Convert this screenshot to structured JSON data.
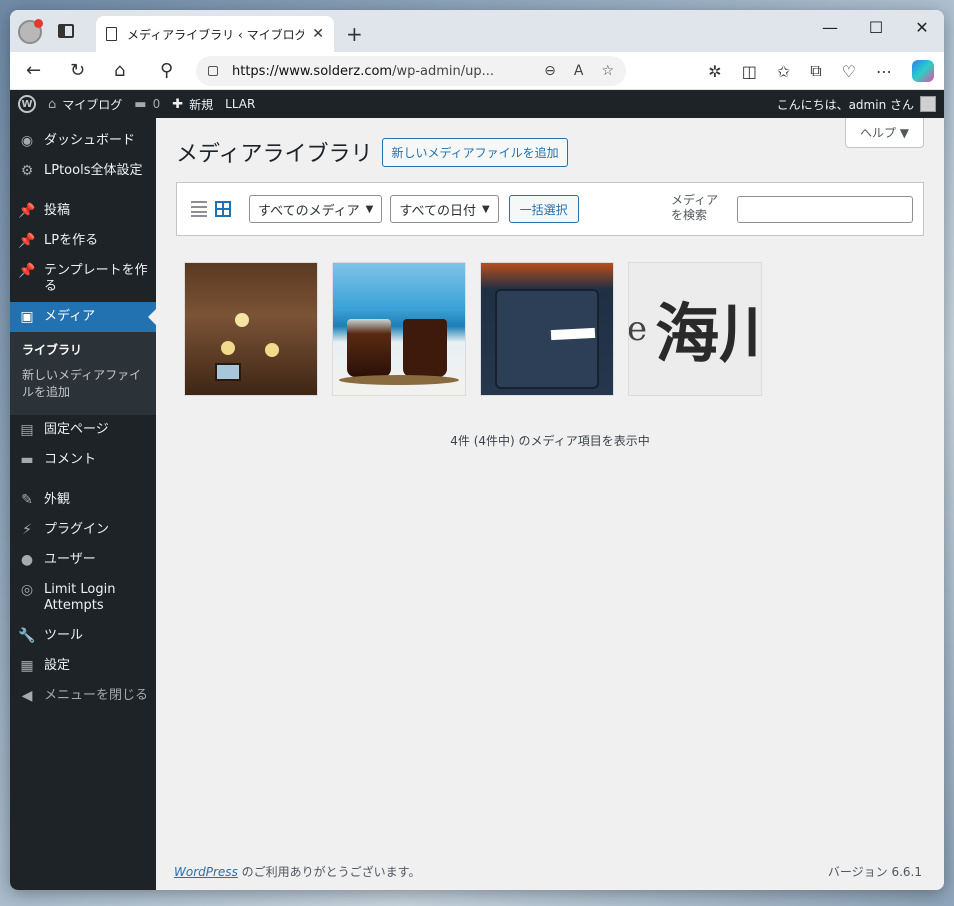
{
  "browser": {
    "tab_title": "メディアライブラリ ‹ マイブログ — Wor",
    "url_host": "https://www.solderz.com",
    "url_path": "/wp-admin/up...",
    "new_tab": "+",
    "win_min": "—",
    "win_max": "☐",
    "win_close": "✕",
    "icons": [
      "back-icon",
      "reload-icon",
      "home-icon",
      "search-icon",
      "zoom-out-icon",
      "read-aloud-icon",
      "favorite-icon",
      "extensions-icon",
      "split-screen-icon",
      "favorites-icon",
      "collections-icon",
      "browser-essentials-icon",
      "more-icon",
      "copilot-icon"
    ]
  },
  "adminbar": {
    "wp_logo": "W",
    "site_name": "マイブログ",
    "comments_count": "0",
    "new_label": "新規",
    "llar_label": "LLAR",
    "greeting": "こんにちは、admin さん"
  },
  "sidebar": {
    "items": [
      {
        "label": "ダッシュボード",
        "icon": "◉"
      },
      {
        "label": "LPtools全体設定",
        "icon": "⚙"
      },
      {
        "label": "投稿",
        "icon": "📌"
      },
      {
        "label": "LPを作る",
        "icon": "📌"
      },
      {
        "label": "テンプレートを作る",
        "icon": "📌"
      },
      {
        "label": "メディア",
        "icon": "▣"
      },
      {
        "label": "固定ページ",
        "icon": "▤"
      },
      {
        "label": "コメント",
        "icon": "▬"
      },
      {
        "label": "外観",
        "icon": "✎"
      },
      {
        "label": "プラグイン",
        "icon": "⚡"
      },
      {
        "label": "ユーザー",
        "icon": "●"
      },
      {
        "label": "Limit Login Attempts",
        "icon": "◎"
      },
      {
        "label": "ツール",
        "icon": "🔧"
      },
      {
        "label": "設定",
        "icon": "▦"
      },
      {
        "label": "メニューを閉じる",
        "icon": "◀"
      }
    ],
    "submenu": {
      "library": "ライブラリ",
      "add_new": "新しいメディアファイルを追加"
    }
  },
  "main": {
    "help": "ヘルプ ▼",
    "title": "メディアライブラリ",
    "add_new": "新しいメディアファイルを追加",
    "filter_media": "すべてのメディア",
    "filter_date": "すべての日付",
    "bulk_select": "一括選択",
    "search_label": "メディアを検索",
    "count_text": "4件 (4件中) のメディア項目を表示中",
    "thumb4_text_e": "e",
    "thumb4_text_kanji": "海川"
  },
  "footer": {
    "wp_link": "WordPress",
    "thanks": " のご利用ありがとうございます。",
    "version": "バージョン 6.6.1"
  },
  "colors": {
    "wp_blue": "#2271b1",
    "admin_dark": "#1d2327"
  }
}
